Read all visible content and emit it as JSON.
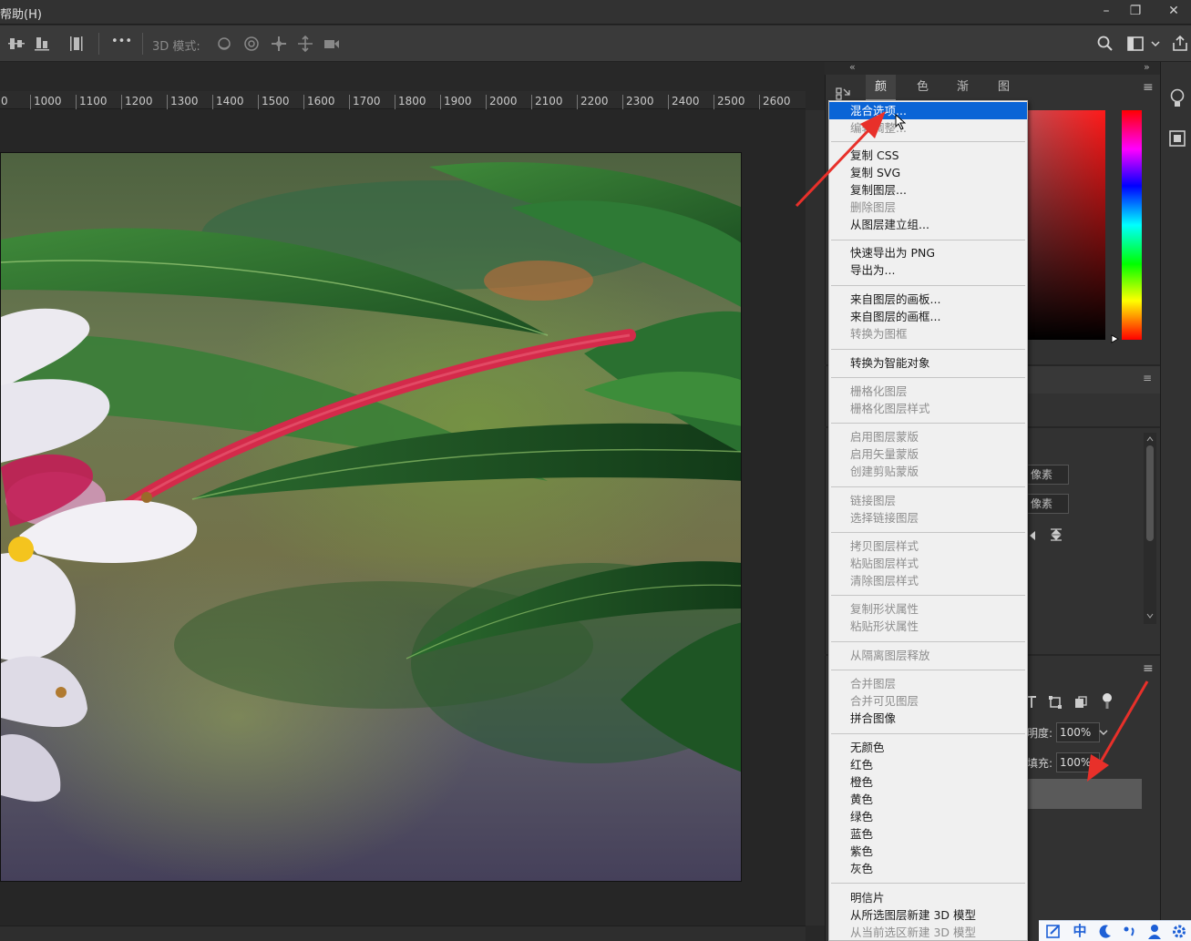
{
  "window": {
    "menu_help": "帮助(H)",
    "minimize": "–",
    "restore": "❐",
    "close": "✕"
  },
  "options_bar": {
    "mode_3d": "3D 模式:",
    "more": "•••"
  },
  "ruler": {
    "ticks": [
      "0",
      "1000",
      "1100",
      "1200",
      "1300",
      "1400",
      "1500",
      "1600",
      "1700",
      "1800",
      "1900",
      "2000",
      "2100",
      "2200",
      "2300",
      "2400",
      "2500",
      "2600"
    ]
  },
  "panel": {
    "collapse_left": "«",
    "collapse_right": "»",
    "tabs": [
      "颜色",
      "色板",
      "渐变",
      "图案"
    ],
    "active_tab": "颜色",
    "menu_icon": "≡",
    "field_px_1": "像素",
    "field_px_2": "像素",
    "opacity_label": "明度:",
    "opacity_value": "100%",
    "fill_label": "填充:",
    "fill_value": "100%"
  },
  "context_menu": {
    "items": [
      {
        "label": "混合选项...",
        "state": "highlighted"
      },
      {
        "label": "编辑调整...",
        "state": "disabled"
      },
      {
        "label": "复制 CSS",
        "state": "enabled"
      },
      {
        "label": "复制 SVG",
        "state": "enabled"
      },
      {
        "label": "复制图层...",
        "state": "enabled"
      },
      {
        "label": "删除图层",
        "state": "disabled"
      },
      {
        "label": "从图层建立组...",
        "state": "enabled"
      },
      {
        "label": "快速导出为 PNG",
        "state": "enabled"
      },
      {
        "label": "导出为...",
        "state": "enabled"
      },
      {
        "label": "来自图层的画板...",
        "state": "enabled"
      },
      {
        "label": "来自图层的画框...",
        "state": "enabled"
      },
      {
        "label": "转换为图框",
        "state": "disabled"
      },
      {
        "label": "转换为智能对象",
        "state": "enabled"
      },
      {
        "label": "栅格化图层",
        "state": "disabled"
      },
      {
        "label": "栅格化图层样式",
        "state": "disabled"
      },
      {
        "label": "启用图层蒙版",
        "state": "disabled"
      },
      {
        "label": "启用矢量蒙版",
        "state": "disabled"
      },
      {
        "label": "创建剪贴蒙版",
        "state": "disabled"
      },
      {
        "label": "链接图层",
        "state": "disabled"
      },
      {
        "label": "选择链接图层",
        "state": "disabled"
      },
      {
        "label": "拷贝图层样式",
        "state": "disabled"
      },
      {
        "label": "粘贴图层样式",
        "state": "disabled"
      },
      {
        "label": "清除图层样式",
        "state": "disabled"
      },
      {
        "label": "复制形状属性",
        "state": "disabled"
      },
      {
        "label": "粘贴形状属性",
        "state": "disabled"
      },
      {
        "label": "从隔离图层释放",
        "state": "disabled"
      },
      {
        "label": "合并图层",
        "state": "disabled"
      },
      {
        "label": "合并可见图层",
        "state": "disabled"
      },
      {
        "label": "拼合图像",
        "state": "enabled"
      },
      {
        "label": "无颜色",
        "state": "enabled"
      },
      {
        "label": "红色",
        "state": "enabled"
      },
      {
        "label": "橙色",
        "state": "enabled"
      },
      {
        "label": "黄色",
        "state": "enabled"
      },
      {
        "label": "绿色",
        "state": "enabled"
      },
      {
        "label": "蓝色",
        "state": "enabled"
      },
      {
        "label": "紫色",
        "state": "enabled"
      },
      {
        "label": "灰色",
        "state": "enabled"
      },
      {
        "label": "明信片",
        "state": "enabled"
      },
      {
        "label": "从所选图层新建 3D 模型",
        "state": "enabled"
      },
      {
        "label": "从当前选区新建 3D 模型",
        "state": "disabled"
      }
    ]
  },
  "ime": {
    "lang": "中"
  },
  "colors": {
    "highlight": "#0a64d6",
    "arrow": "#e8302a",
    "stem": "#d42a4a"
  }
}
